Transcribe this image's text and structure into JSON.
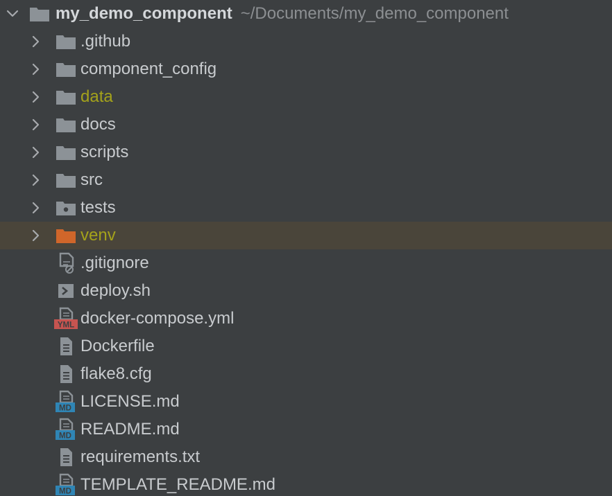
{
  "project_tree": {
    "root": {
      "name": "my_demo_component",
      "path": "~/Documents/my_demo_component",
      "expanded": true,
      "icon": "folder-icon"
    },
    "items": [
      {
        "label": ".github",
        "type": "folder",
        "icon": "folder-icon",
        "color": "#c8cbce"
      },
      {
        "label": "component_config",
        "type": "folder",
        "icon": "folder-icon",
        "color": "#c8cbce"
      },
      {
        "label": "data",
        "type": "folder",
        "icon": "folder-icon",
        "color": "#a4a21b"
      },
      {
        "label": "docs",
        "type": "folder",
        "icon": "folder-icon",
        "color": "#c8cbce"
      },
      {
        "label": "scripts",
        "type": "folder",
        "icon": "folder-icon",
        "color": "#c8cbce"
      },
      {
        "label": "src",
        "type": "folder",
        "icon": "folder-icon",
        "color": "#c8cbce"
      },
      {
        "label": "tests",
        "type": "folder",
        "icon": "test-folder-icon",
        "color": "#c8cbce"
      },
      {
        "label": "venv",
        "type": "folder",
        "icon": "excluded-folder-icon",
        "color": "#a4a21b",
        "highlighted": true
      },
      {
        "label": ".gitignore",
        "type": "file",
        "icon": "ignore-file-icon",
        "color": "#c8cbce"
      },
      {
        "label": "deploy.sh",
        "type": "file",
        "icon": "shell-script-icon",
        "color": "#c8cbce"
      },
      {
        "label": "docker-compose.yml",
        "type": "file",
        "icon": "yml-file-icon",
        "color": "#c8cbce"
      },
      {
        "label": "Dockerfile",
        "type": "file",
        "icon": "text-file-icon",
        "color": "#c8cbce"
      },
      {
        "label": "flake8.cfg",
        "type": "file",
        "icon": "text-file-icon",
        "color": "#c8cbce"
      },
      {
        "label": "LICENSE.md",
        "type": "file",
        "icon": "markdown-file-icon",
        "color": "#c8cbce"
      },
      {
        "label": "README.md",
        "type": "file",
        "icon": "markdown-file-icon",
        "color": "#c8cbce"
      },
      {
        "label": "requirements.txt",
        "type": "file",
        "icon": "text-file-icon",
        "color": "#c8cbce"
      },
      {
        "label": "TEMPLATE_README.md",
        "type": "file",
        "icon": "markdown-file-icon",
        "color": "#c8cbce"
      }
    ],
    "icon_badges": {
      "yml": "YML",
      "md": "MD"
    },
    "colors": {
      "background": "#3c3f41",
      "highlight_row": "#4a453a",
      "folder": "#8c9297",
      "excluded_folder": "#d0662a",
      "yml_badge": "#c75450",
      "md_badge": "#2f85b5"
    }
  }
}
